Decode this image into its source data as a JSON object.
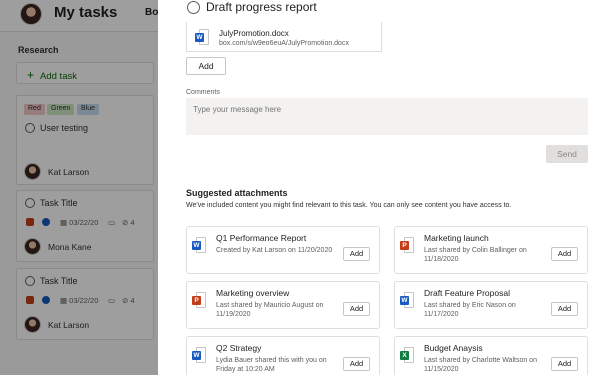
{
  "app": {
    "title": "My tasks",
    "tab_fragment": "Bo"
  },
  "board": {
    "column_title": "Research",
    "add_task_label": "Add task",
    "labels": [
      {
        "text": "Red",
        "color": "#f4c9c9"
      },
      {
        "text": "Green",
        "color": "#cde8c3"
      },
      {
        "text": "Blue",
        "color": "#c7dcf2"
      }
    ],
    "task1": {
      "title": "User testing",
      "assignee": "Kat Larson"
    },
    "task2": {
      "title": "Task Title",
      "date": "03/22/20",
      "attachments": "4",
      "assignee": "Mona Kane"
    },
    "task3": {
      "title": "Task Title",
      "date": "03/22/20",
      "attachments": "4",
      "assignee": "Kat Larson"
    }
  },
  "panel": {
    "task_title": "Draft progress report",
    "file": {
      "name": "JulyPromotion.docx",
      "url": "box.com/s/w9eo6euA/JulyPromotion.docx",
      "icon": "word-icon"
    },
    "add_label": "Add",
    "comments_label": "Comments",
    "comment_placeholder": "Type your message here",
    "send_label": "Send",
    "suggested_title": "Suggested attachments",
    "suggested_sub": "We've included content you might find relevant to this task. You can only see content you have access to.",
    "attachments": [
      {
        "title": "Q1 Performance Report",
        "meta": "Created by Kat Larson on 11/20/2020",
        "type": "word",
        "add": "Add"
      },
      {
        "title": "Marketing launch",
        "meta": "Last shared by Colin Ballinger on 11/18/2020",
        "type": "powerpoint",
        "add": "Add"
      },
      {
        "title": "Marketing overview",
        "meta": "Last shared by Mauricio August on 11/19/2020",
        "type": "powerpoint",
        "add": "Add"
      },
      {
        "title": "Draft Feature Proposal",
        "meta": "Last shared by Eric Nason on 11/17/2020",
        "type": "word",
        "add": "Add"
      },
      {
        "title": "Q2 Strategy",
        "meta": "Lydia Bauer shared this with you on Friday at 10:20 AM",
        "type": "word",
        "add": "Add"
      },
      {
        "title": "Budget Anaysis",
        "meta": "Last shared by Charlotte Waltson on 11/15/2020",
        "type": "excel",
        "add": "Add"
      }
    ]
  }
}
